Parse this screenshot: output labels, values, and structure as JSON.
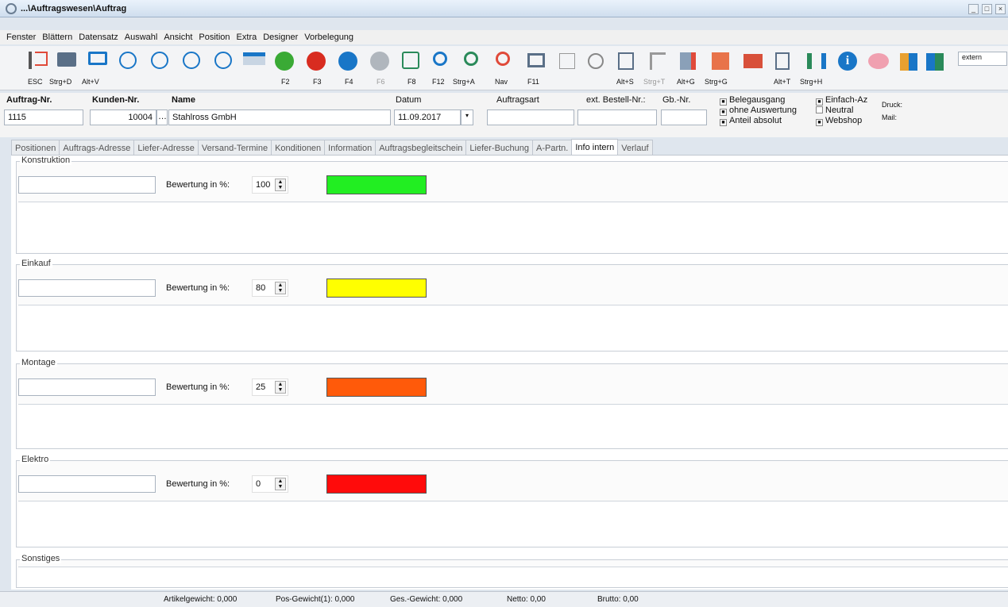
{
  "window": {
    "title": "...\\Auftragswesen\\Auftrag",
    "controls": [
      "_",
      "□",
      "×"
    ]
  },
  "menu": [
    "Fenster",
    "Blättern",
    "Datensatz",
    "Auswahl",
    "Ansicht",
    "Position",
    "Extra",
    "Designer",
    "Vorbelegung"
  ],
  "toolbar": {
    "keys": [
      "ESC",
      "Strg+D",
      "Alt+V",
      "F2",
      "F3",
      "F4",
      "F6",
      "F8",
      "F12",
      "Strg+A",
      "Nav",
      "F11",
      "Alt+S",
      "Strg+T",
      "Alt+G",
      "Strg+G",
      "Alt+T",
      "Strg+H"
    ],
    "search_value": "extern"
  },
  "header": {
    "auftrag_label": "Auftrag-Nr.",
    "auftrag_value": "1115",
    "kunden_label": "Kunden-Nr.",
    "kunden_value": "10004",
    "name_label": "Name",
    "name_value": "Stahlross GmbH",
    "datum_label": "Datum",
    "datum_value": "11.09.2017",
    "auftragsart_label": "Auftragsart",
    "bestell_label": "ext. Bestell-Nr.:",
    "gb_label": "Gb.-Nr.",
    "checks": {
      "belegausgang": "Belegausgang",
      "ohne": "ohne Auswertung",
      "anteil": "Anteil absolut",
      "einfach": "Einfach-Az",
      "neutral": "Neutral",
      "webshop": "Webshop"
    },
    "druck": "Druck:",
    "mail": "Mail:"
  },
  "tabs": [
    "Positionen",
    "Auftrags-Adresse",
    "Liefer-Adresse",
    "Versand-Termine",
    "Konditionen",
    "Information",
    "Auftragsbegleitschein",
    "Liefer-Buchung",
    "A-Partn.",
    "Info intern",
    "Verlauf"
  ],
  "groups": [
    {
      "title": "Konstruktion",
      "label": "Bewertung in %:",
      "value": "100",
      "color": "#22ee22"
    },
    {
      "title": "Einkauf",
      "label": "Bewertung in %:",
      "value": "80",
      "color": "#ffff00"
    },
    {
      "title": "Montage",
      "label": "Bewertung in %:",
      "value": "25",
      "color": "#ff5a0a"
    },
    {
      "title": "Elektro",
      "label": "Bewertung in %:",
      "value": "0",
      "color": "#ff0b0b"
    }
  ],
  "sonstiges": "Sonstiges",
  "status": {
    "artikel": "Artikelgewicht: 0,000",
    "pos": "Pos-Gewicht(1): 0,000",
    "ges": "Ges.-Gewicht: 0,000",
    "netto": "Netto: 0,00",
    "brutto": "Brutto: 0,00"
  }
}
